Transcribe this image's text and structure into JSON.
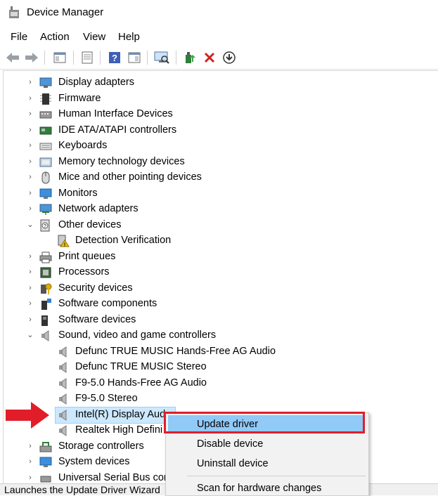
{
  "window": {
    "title": "Device Manager"
  },
  "menu": [
    "File",
    "Action",
    "View",
    "Help"
  ],
  "toolbar": {
    "buttons": [
      "back-icon",
      "forward-icon",
      "show-hide-console-tree-icon",
      "properties-icon",
      "help-icon",
      "show-action-pane-icon",
      "scan-hardware-icon",
      "update-driver-icon",
      "uninstall-icon",
      "download-icon"
    ]
  },
  "tree": {
    "categories": [
      {
        "label": "Display adapters",
        "expanded": false
      },
      {
        "label": "Firmware",
        "expanded": false
      },
      {
        "label": "Human Interface Devices",
        "expanded": false
      },
      {
        "label": "IDE ATA/ATAPI controllers",
        "expanded": false
      },
      {
        "label": "Keyboards",
        "expanded": false
      },
      {
        "label": "Memory technology devices",
        "expanded": false
      },
      {
        "label": "Mice and other pointing devices",
        "expanded": false
      },
      {
        "label": "Monitors",
        "expanded": false
      },
      {
        "label": "Network adapters",
        "expanded": false
      },
      {
        "label": "Other devices",
        "expanded": true
      },
      {
        "label": "Detection Verification",
        "child": true
      },
      {
        "label": "Print queues",
        "expanded": false
      },
      {
        "label": "Processors",
        "expanded": false
      },
      {
        "label": "Security devices",
        "expanded": false
      },
      {
        "label": "Software components",
        "expanded": false
      },
      {
        "label": "Software devices",
        "expanded": false
      },
      {
        "label": "Sound, video and game controllers",
        "expanded": true
      },
      {
        "label": "Defunc TRUE MUSIC Hands-Free AG Audio",
        "child": true
      },
      {
        "label": "Defunc TRUE MUSIC Stereo",
        "child": true
      },
      {
        "label": "F9-5.0 Hands-Free AG Audio",
        "child": true
      },
      {
        "label": "F9-5.0 Stereo",
        "child": true
      },
      {
        "label": "Intel(R) Display Aud",
        "child": true,
        "selected": true
      },
      {
        "label": "Realtek High Defini",
        "child": true
      },
      {
        "label": "Storage controllers",
        "expanded": false
      },
      {
        "label": "System devices",
        "expanded": false
      },
      {
        "label": "Universal Serial Bus con",
        "expanded": false
      }
    ]
  },
  "context_menu": {
    "items": [
      "Update driver",
      "Disable device",
      "Uninstall device",
      "Scan for hardware changes"
    ],
    "highlighted": "Update driver"
  },
  "status": {
    "text": "Launches the Update Driver Wizard"
  },
  "colors": {
    "selection": "#cce8ff",
    "menu_highlight": "#91c9f7",
    "annotation": "#e11d2a"
  }
}
